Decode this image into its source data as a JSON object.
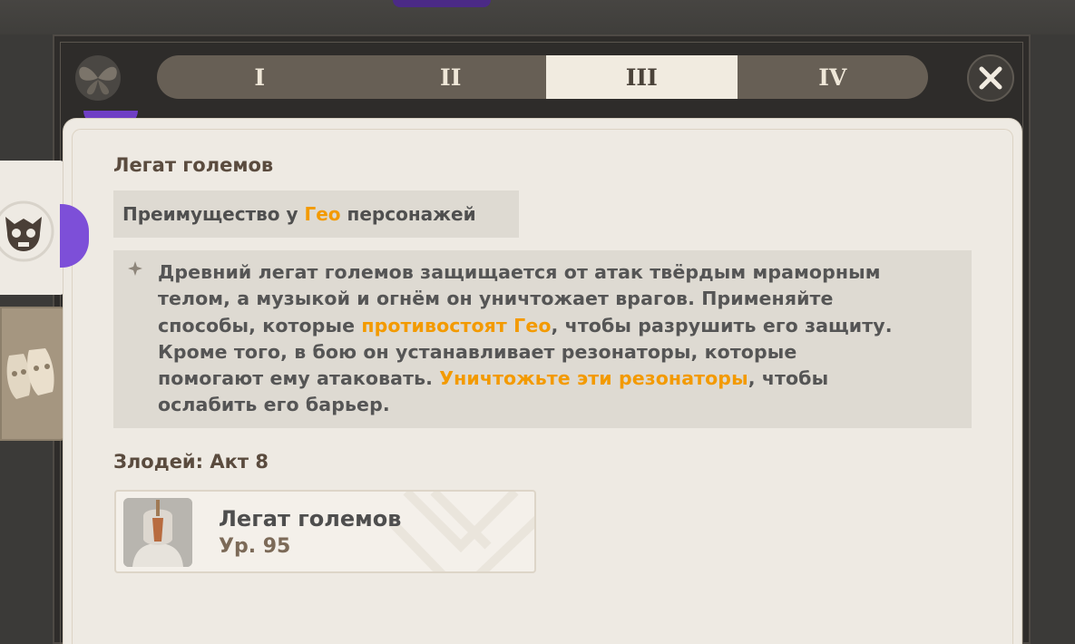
{
  "tabs": [
    {
      "label": "I",
      "active": false
    },
    {
      "label": "II",
      "active": false
    },
    {
      "label": "III",
      "active": true
    },
    {
      "label": "IV",
      "active": false
    }
  ],
  "boss": {
    "title": "Легат големов",
    "advantage": {
      "prefix": "Преимущество у ",
      "element": "Гео",
      "suffix": " персонажей"
    },
    "description_lines": [
      [
        {
          "t": "Древний легат големов защищается от атак твёрдым мраморным",
          "h": false
        }
      ],
      [
        {
          "t": "телом, а музыкой и огнём он уничтожает врагов. Применяйте",
          "h": false
        }
      ],
      [
        {
          "t": "способы, которые ",
          "h": false
        },
        {
          "t": "противостоят Гео",
          "h": true
        },
        {
          "t": ", чтобы разрушить его защиту.",
          "h": false
        }
      ],
      [
        {
          "t": "Кроме того, в бою он устанавливает резонаторы, которые",
          "h": false
        }
      ],
      [
        {
          "t": "помогают ему атаковать. ",
          "h": false
        },
        {
          "t": "Уничтожьте эти резонаторы",
          "h": true
        },
        {
          "t": ", чтобы",
          "h": false
        }
      ],
      [
        {
          "t": "ослабить его барьер.",
          "h": false
        }
      ]
    ]
  },
  "villain": {
    "heading": "Злодей: Акт 8",
    "enemy_name": "Легат големов",
    "enemy_level": "Ур. 95"
  },
  "colors": {
    "highlight": "#f39a00",
    "panel": "#eeeae3",
    "text": "#555555",
    "heading": "#5a4b3e",
    "tab_bar": "#675f55",
    "tab_active": "#f1ebe0"
  },
  "icons": {
    "close": "close-icon",
    "butterfly": "butterfly-icon",
    "boss_side": "horned-skull-icon",
    "masks_side": "theater-masks-icon",
    "bullet": "diamond-star-icon"
  }
}
